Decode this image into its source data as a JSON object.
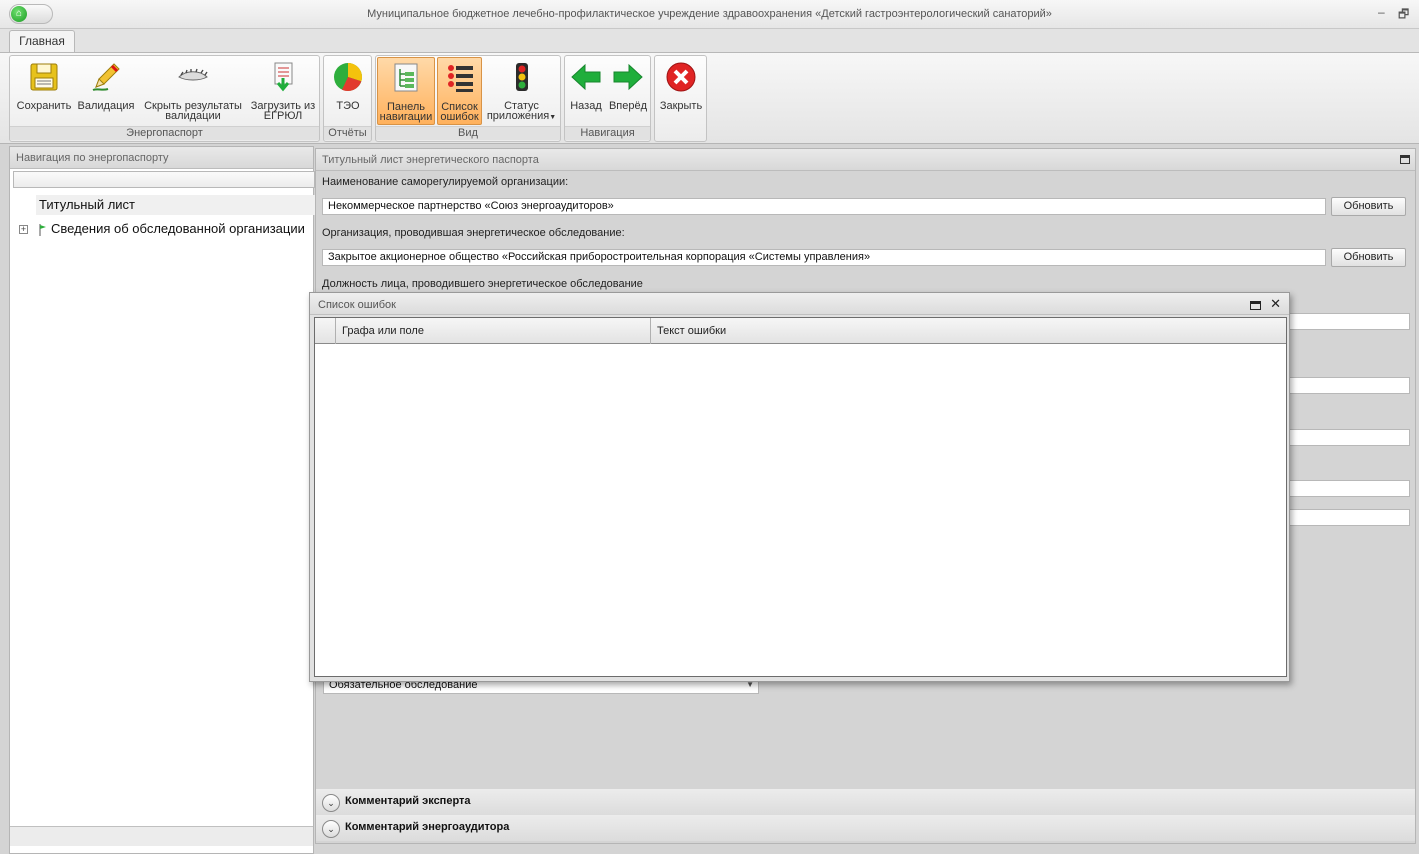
{
  "window": {
    "title": "Муниципальное бюджетное лечебно-профилактическое учреждение здравоохранения «Детский гастроэнтерологический санаторий»",
    "minimize_glyph": "–",
    "restore_glyph": "🗗"
  },
  "ribbon": {
    "tab": "Главная",
    "groups": {
      "energy": {
        "label": "Энергопаспорт"
      },
      "reports": {
        "label": "Отчёты"
      },
      "view": {
        "label": "Вид"
      },
      "navigation": {
        "label": "Навигация"
      }
    },
    "buttons": {
      "save": {
        "label": "Сохранить",
        "icon": "floppy-disk-icon"
      },
      "validate": {
        "label": "Валидация",
        "icon": "pencil-icon"
      },
      "hide_validation": {
        "label_line1": "Скрыть результаты",
        "label_line2": "валидации",
        "icon": "eye-closed-icon"
      },
      "load_egrul": {
        "label_line1": "Загрузить из",
        "label_line2": "ЕГРЮЛ",
        "icon": "document-download-icon"
      },
      "teo": {
        "label": "ТЭО",
        "icon": "pie-chart-icon"
      },
      "nav_panel": {
        "label_line1": "Панель",
        "label_line2": "навигации",
        "icon": "navigation-tree-icon"
      },
      "error_list": {
        "label_line1": "Список",
        "label_line2": "ошибок",
        "icon": "list-icon"
      },
      "app_status": {
        "label_line1": "Статус",
        "label_line2": "приложения",
        "icon": "traffic-light-icon"
      },
      "back": {
        "label": "Назад",
        "icon": "arrow-left-icon"
      },
      "forward": {
        "label": "Вперёд",
        "icon": "arrow-right-icon"
      },
      "close": {
        "label": "Закрыть",
        "icon": "close-circle-icon"
      }
    },
    "colors": {
      "active_button": "#ffb15c",
      "arrow_green": "#1fae3b",
      "close_red": "#e02424"
    }
  },
  "left_panel": {
    "title": "Навигация по энергопаспорту",
    "tree": [
      {
        "label": "Титульный лист",
        "selected": true
      },
      {
        "label": "Сведения об обследованной организации",
        "selected": false,
        "expander": "+"
      }
    ]
  },
  "main_panel": {
    "title": "Титульный лист энергетического паспорта",
    "fields": {
      "sro_label": "Наименование саморегулируемой организации:",
      "sro_value": "Некоммерческое партнерство «Союз энергоаудиторов»",
      "org_label": "Организация, проводившая энергетическое обследование:",
      "org_value": "Закрытое акционерное общество «Российская приборостроительная корпорация «Системы управления»",
      "position_label": "Должность лица, проводившего энергетическое обследование",
      "survey_type": "Обязательное обследование"
    },
    "update_button": "Обновить",
    "sections": {
      "expert_comment": "Комментарий эксперта",
      "auditor_comment": "Комментарий энергоаудитора"
    }
  },
  "error_window": {
    "title": "Список ошибок",
    "close_glyph": "✕",
    "columns": [
      "Графа или поле",
      "Текст ошибки"
    ],
    "rows": []
  }
}
